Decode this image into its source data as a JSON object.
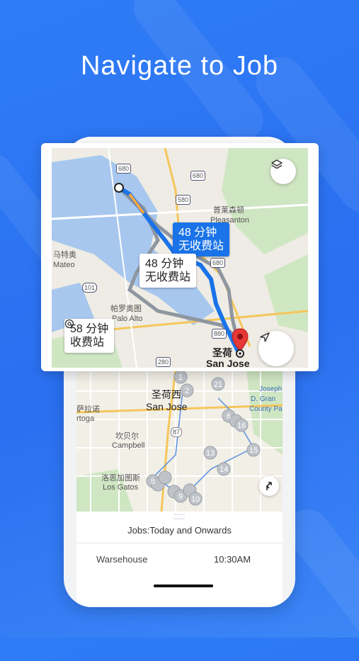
{
  "header": {
    "title": "Navigate to Job"
  },
  "colors": {
    "background": "#2f7cf6",
    "route_primary": "#1a73e8",
    "pin": "#e53935"
  },
  "route_map": {
    "route_options": [
      {
        "duration": "48 分钟",
        "note": "无收费站"
      },
      {
        "duration": "48 分钟",
        "note": "无收费站"
      },
      {
        "duration": "58 分钟",
        "note": "收费站"
      }
    ],
    "labels": {
      "pleasanton_cn": "普莱森顿",
      "pleasanton_en": "Pleasanton",
      "mateo_cn": "马特奥",
      "mateo_en": "Mateo",
      "paloalto_cn": "帕罗奥图",
      "paloalto_en": "Palo Alto",
      "destination_cn": "圣荷",
      "destination_en": "San Jose",
      "hwy_680a": "680",
      "hwy_680b": "680",
      "hwy_580": "580",
      "hwy_101": "101",
      "hwy_880": "880",
      "hwy_280": "280",
      "hwy_680c": "680"
    },
    "icons": [
      "layers-icon",
      "navigation-arrow-icon",
      "toll-icon",
      "destination-pin-icon"
    ]
  },
  "phone_map": {
    "labels": {
      "sanjose_cn": "圣荷西",
      "sanjose_en": "San Jose",
      "campbell_cn": "坎贝尔",
      "campbell_en": "Campbell",
      "losgatos_cn": "洛思加图斯",
      "losgatos_en": "Los Gatos",
      "ratoga_cn": "萨拉诺",
      "ratoga_en": "rtoga",
      "joseph_1": "Joseph",
      "joseph_2": "D. Gran",
      "joseph_3": "County Pa",
      "hwy_87": "87"
    },
    "markers": [
      "1",
      "2",
      "21",
      "6",
      "15",
      "16",
      "13",
      "14",
      "8",
      "9",
      "10"
    ]
  },
  "jobs": {
    "title": "Jobs:Today and Onwards",
    "items": [
      {
        "location": "Warsehouse",
        "time": "10:30AM"
      }
    ]
  }
}
